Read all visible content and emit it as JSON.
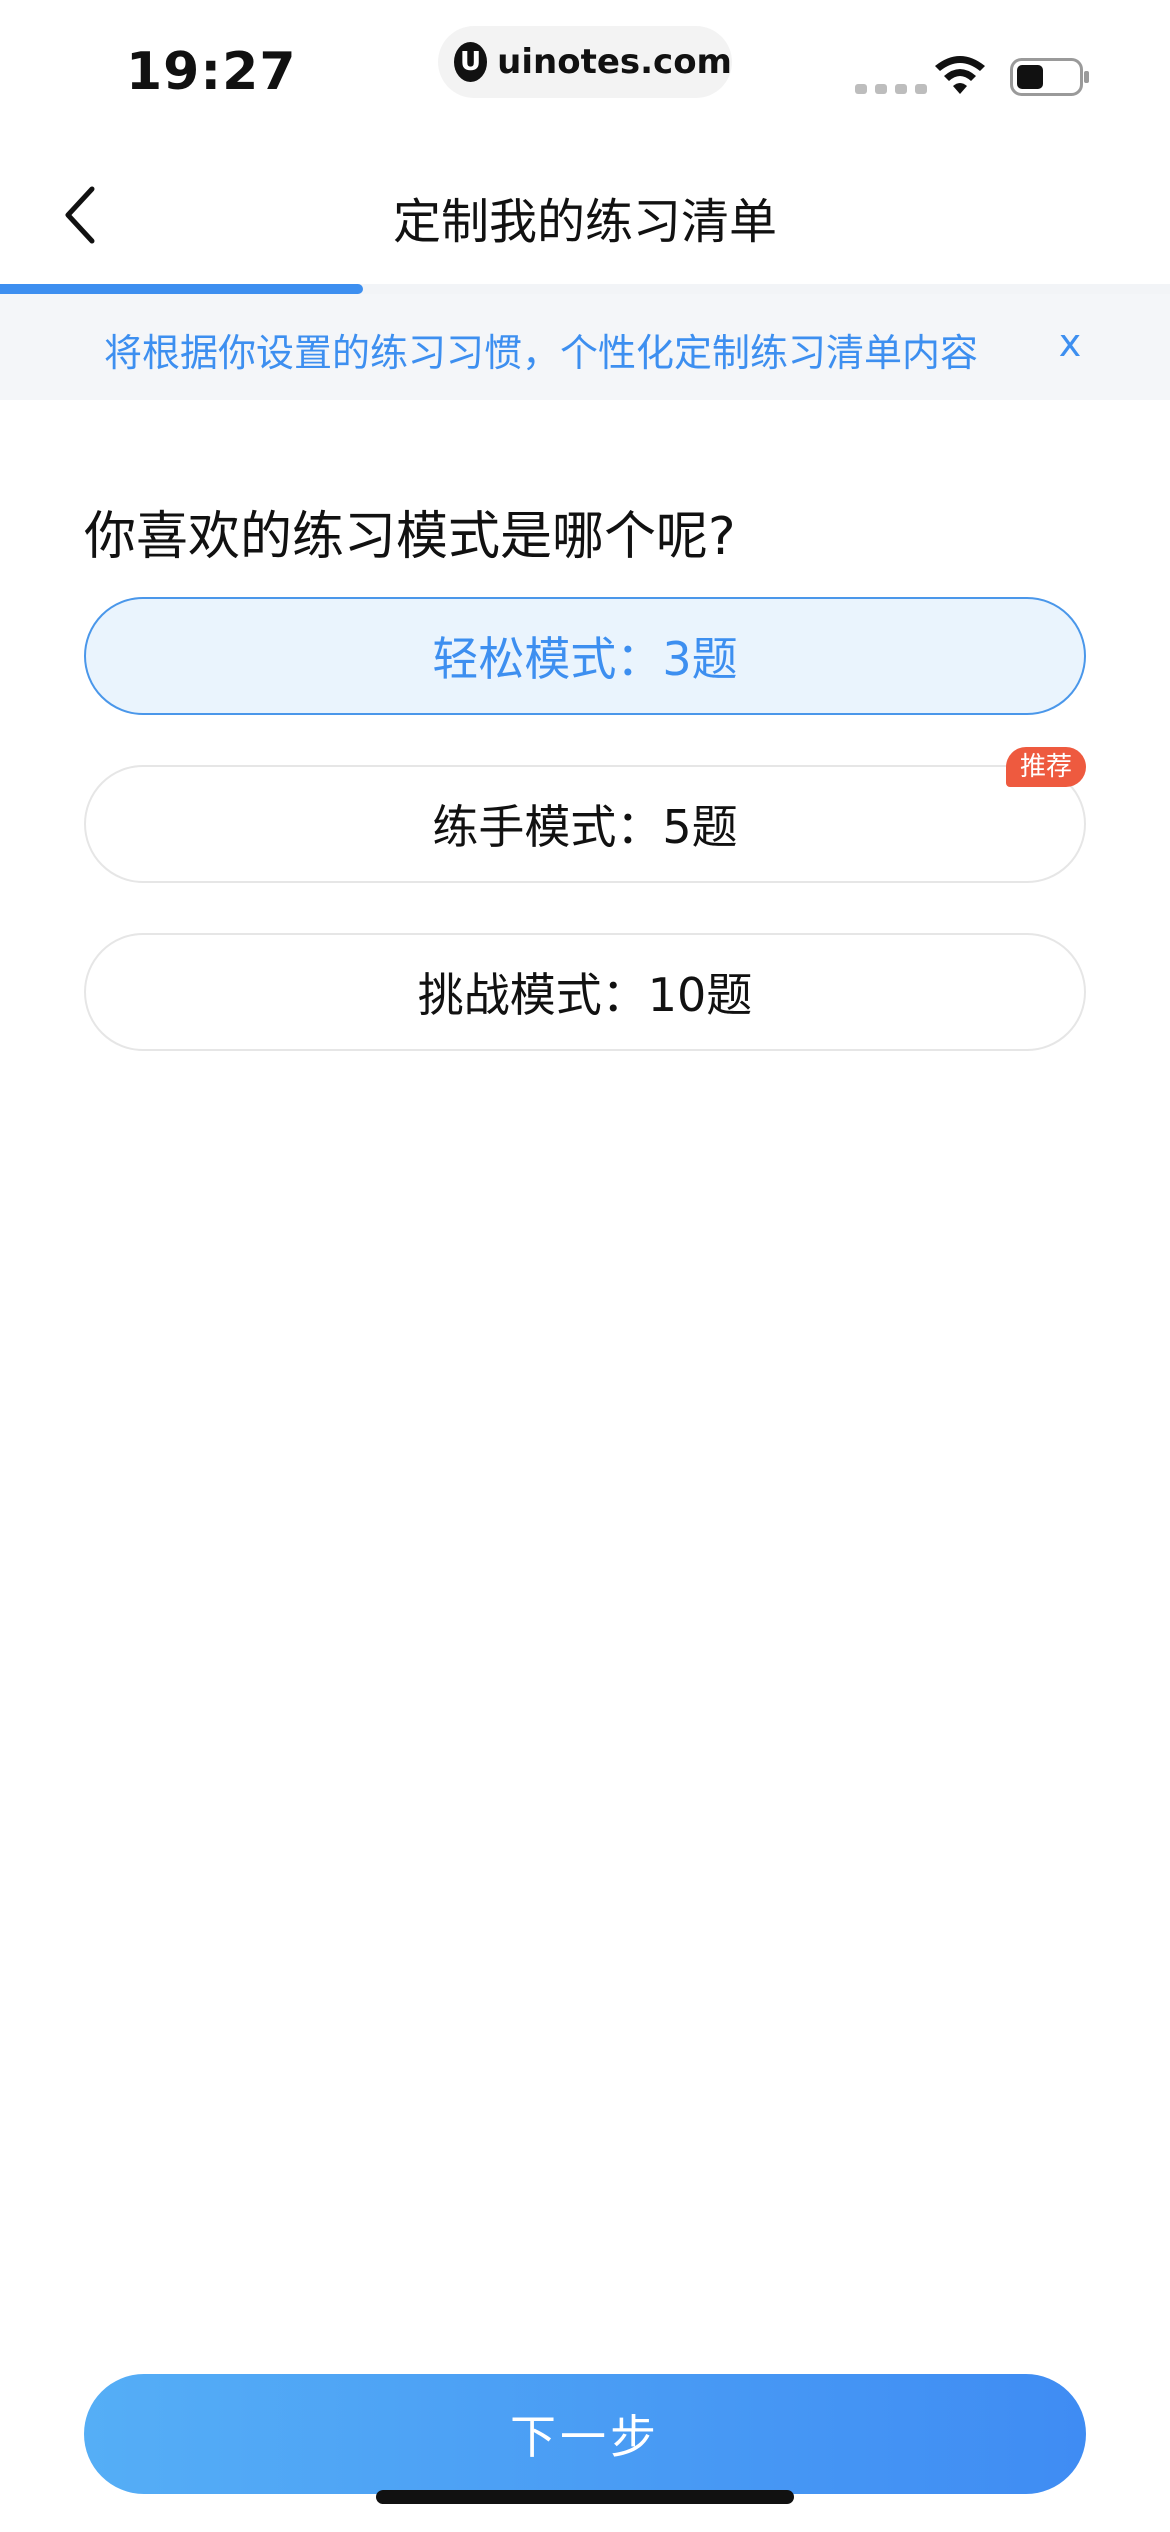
{
  "status_bar": {
    "time": "19:27",
    "url": "uinotes.com",
    "url_logo": "U"
  },
  "nav": {
    "title": "定制我的练习清单",
    "back_icon": "chevron-left-icon"
  },
  "progress": {
    "fraction": 0.25,
    "color": "#3d8ff0"
  },
  "banner": {
    "text": "将根据你设置的练习习惯，个性化定制练习清单内容",
    "close_label": "x"
  },
  "question": "你喜欢的练习模式是哪个呢?",
  "options": [
    {
      "label": "轻松模式：3题",
      "selected": true
    },
    {
      "label": "练手模式：5题",
      "selected": false,
      "badge": "推荐"
    },
    {
      "label": "挑战模式：10题",
      "selected": false
    }
  ],
  "next_button": {
    "label": "下一步"
  },
  "colors": {
    "accent": "#3d8ff0",
    "selected_bg": "#eaf4fd",
    "badge": "#ee5a3f"
  }
}
